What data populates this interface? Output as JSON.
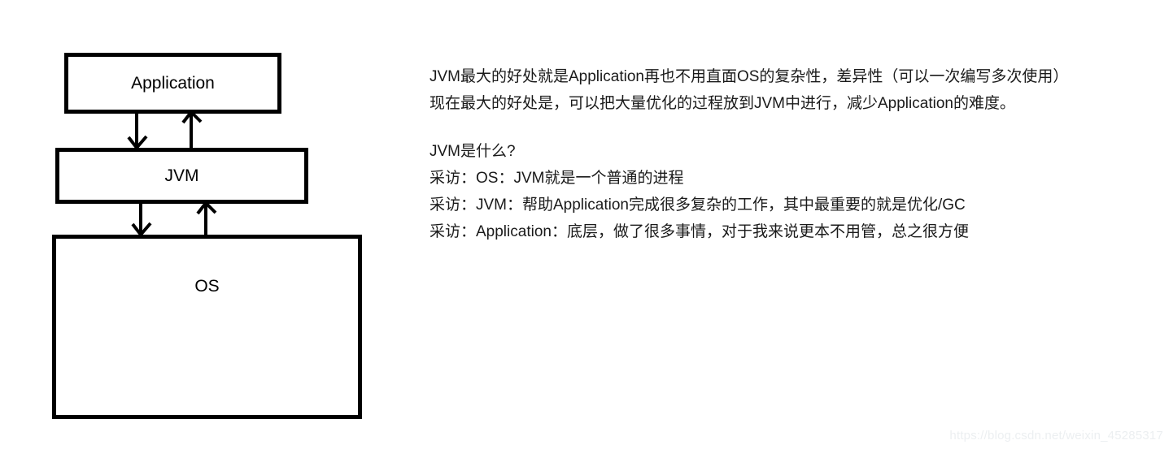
{
  "diagram": {
    "nodes": [
      {
        "id": "application",
        "label": "Application"
      },
      {
        "id": "jvm",
        "label": "JVM"
      },
      {
        "id": "os",
        "label": "OS"
      }
    ],
    "connections": [
      {
        "from": "application",
        "to": "jvm",
        "direction": "down"
      },
      {
        "from": "jvm",
        "to": "application",
        "direction": "up"
      },
      {
        "from": "jvm",
        "to": "os",
        "direction": "down"
      },
      {
        "from": "os",
        "to": "jvm",
        "direction": "up"
      }
    ],
    "stroke_color": "#000000"
  },
  "notes": {
    "paragraph": [
      "JVM最大的好处就是Application再也不用直面OS的复杂性，差异性（可以一次编写多次使用）",
      "现在最大的好处是，可以把大量优化的过程放到JVM中进行，减少Application的难度。"
    ],
    "question": "JVM是什么?",
    "interviews": [
      "采访：OS：JVM就是一个普通的进程",
      "采访：JVM：帮助Application完成很多复杂的工作，其中最重要的就是优化/GC",
      "采访：Application：底层，做了很多事情，对于我来说更本不用管，总之很方便"
    ]
  },
  "watermark": "https://blog.csdn.net/weixin_45285317"
}
